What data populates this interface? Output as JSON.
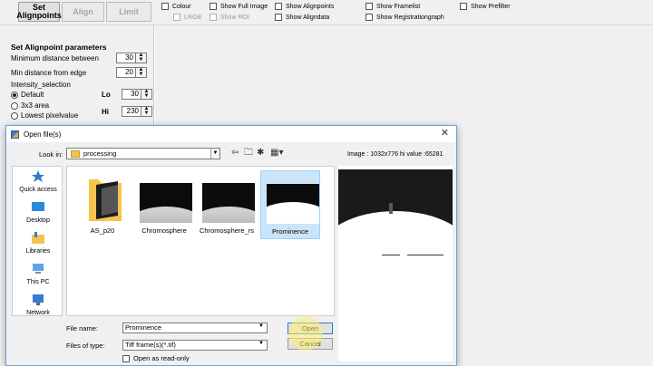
{
  "toolbar": {
    "tabs": [
      {
        "label": "Set Alignpoints",
        "active": true
      },
      {
        "label": "Align",
        "active": false
      },
      {
        "label": "Limit",
        "active": false
      }
    ],
    "checkboxes": {
      "colour": "Colour",
      "lrgb": "LRGB",
      "show_full_image": "Show Full Image",
      "show_roi": "Show ROI",
      "show_alignpoints": "Show Alignpoints",
      "show_aligndata": "Show Aligndata",
      "show_framelist": "Show Framelist",
      "show_registrationgraph": "Show Registrationgraph",
      "show_prefilter": "Show Prefilter"
    }
  },
  "left_panel": {
    "title": "Set Alignpoint parameters",
    "min_distance_between_label": "Minimum distance between",
    "min_distance_between_value": "30",
    "min_distance_edge_label": "Min distance from edge",
    "min_distance_edge_value": "20",
    "intensity_label": "Intensity_selection",
    "options": [
      "Default",
      "3x3 area",
      "Lowest pixelvalue"
    ],
    "selected_option": "Default",
    "lo_label": "Lo",
    "lo_value": "30",
    "hi_label": "Hi",
    "hi_value": "230"
  },
  "dialog": {
    "title": "Open file(s)",
    "look_in_label": "Look in:",
    "look_in_value": "processing",
    "image_info": "Image : 1032x776 hi value :65281",
    "places": [
      "Quick access",
      "Desktop",
      "Libraries",
      "This PC",
      "Network"
    ],
    "files": [
      {
        "name": "AS_p20",
        "kind": "folder"
      },
      {
        "name": "Chromosphere",
        "kind": "image"
      },
      {
        "name": "Chromosphere_rs",
        "kind": "image"
      },
      {
        "name": "Prominence",
        "kind": "image",
        "selected": true
      }
    ],
    "file_name_label": "File name:",
    "file_name_value": "Prominence",
    "files_of_type_label": "Files of type:",
    "files_of_type_value": "Tiff frame(s)(*.tif)",
    "open_readonly_label": "Open as read-only",
    "open_button": "Open",
    "cancel_button": "Cancel"
  },
  "colors": {
    "dialog_border": "#6f9fd8",
    "selection_bg": "#cce4f7",
    "cursor_highlight": "#fff06e"
  }
}
